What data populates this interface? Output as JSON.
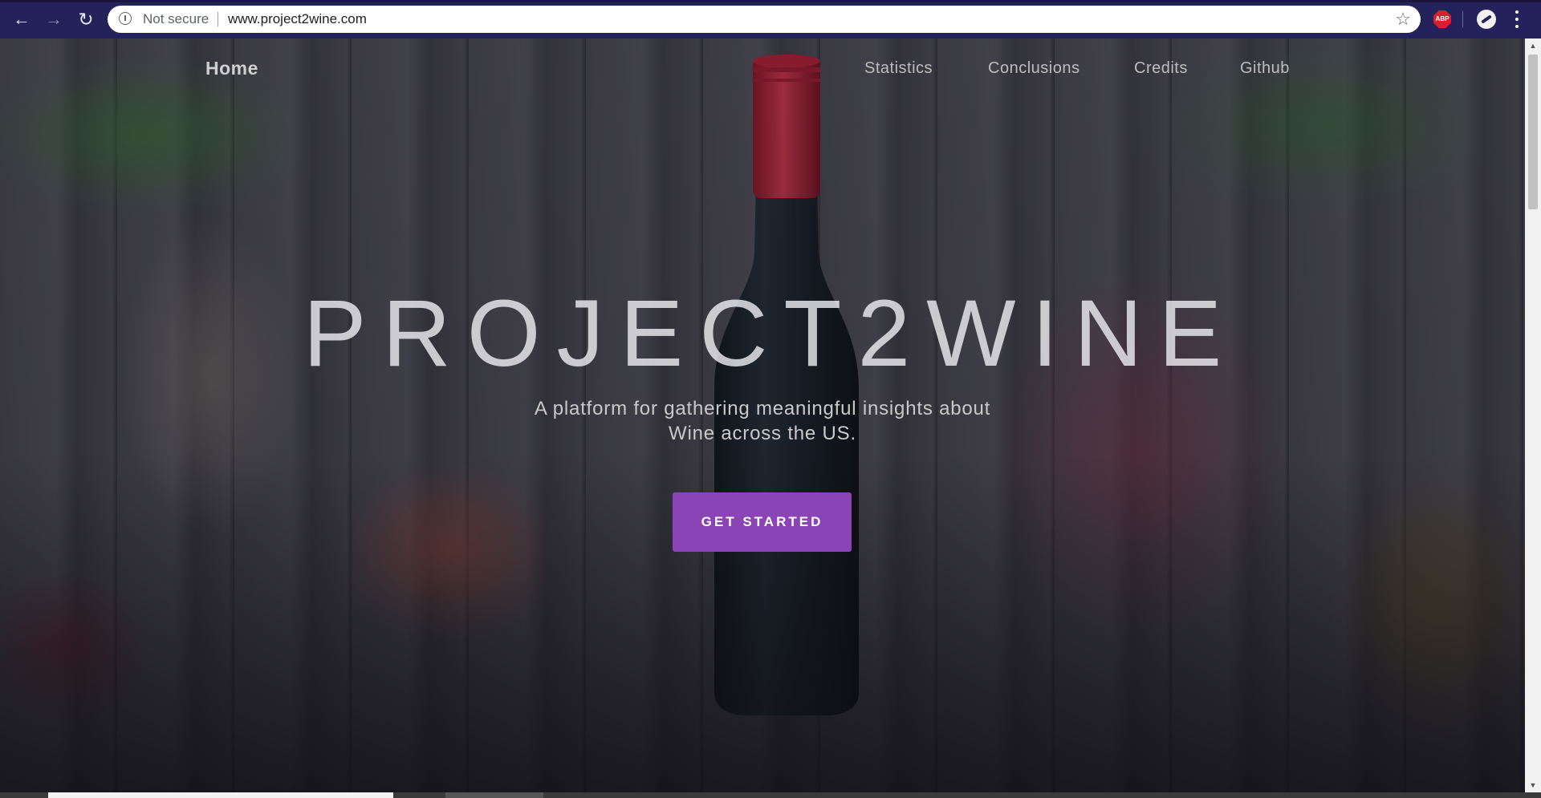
{
  "browser": {
    "security_label": "Not secure",
    "url": "www.project2wine.com",
    "extension_abp": "ABP",
    "icons": [
      "back-arrow-icon",
      "forward-arrow-icon",
      "reload-icon",
      "info-icon",
      "star-icon",
      "adblock-icon",
      "profile-icon",
      "kebab-menu-icon"
    ]
  },
  "nav": {
    "home": "Home",
    "items": [
      {
        "label": "Statistics"
      },
      {
        "label": "Conclusions"
      },
      {
        "label": "Credits"
      },
      {
        "label": "Github"
      }
    ]
  },
  "hero": {
    "title": "PROJECT2WINE",
    "subtitle": "A platform for gathering meaningful insights about Wine across the US.",
    "cta_label": "GET STARTED"
  },
  "colors": {
    "cta": "#8a44b6",
    "chrome": "#23225a",
    "bottle_cap": "#c8233a"
  }
}
